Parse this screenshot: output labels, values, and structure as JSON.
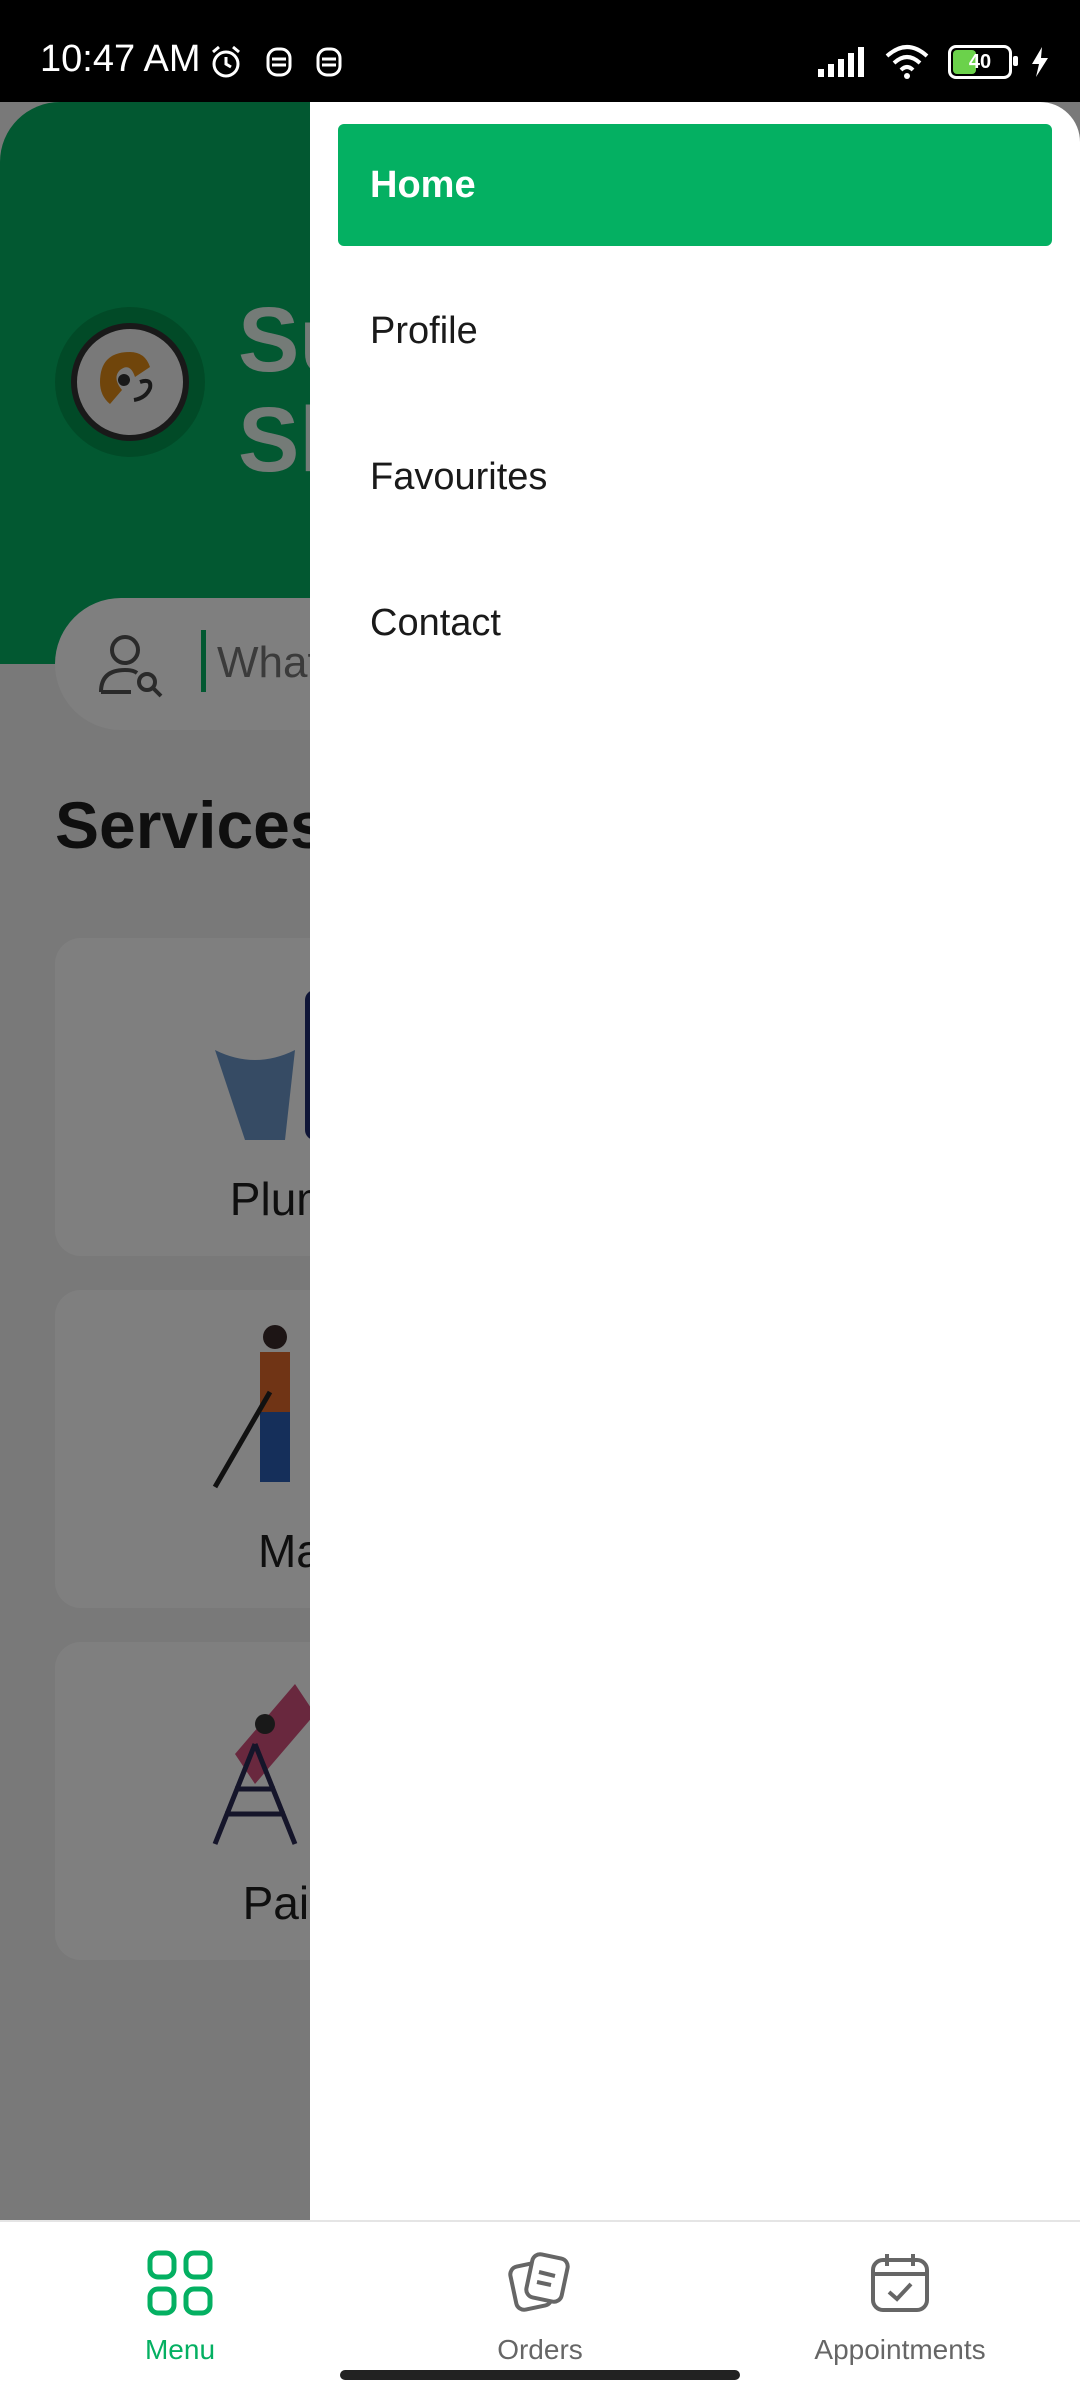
{
  "status_bar": {
    "time": "10:47 AM",
    "battery": "40"
  },
  "app": {
    "brand_text": "Su\nSl",
    "search": {
      "placeholder": "What"
    },
    "services_title": "Services",
    "services": [
      {
        "label": "Plumb"
      },
      {
        "label": "Mai"
      },
      {
        "label": "Paint"
      }
    ]
  },
  "drawer": {
    "items": [
      {
        "label": "Home",
        "active": true
      },
      {
        "label": "Profile",
        "active": false
      },
      {
        "label": "Favourites",
        "active": false
      },
      {
        "label": "Contact",
        "active": false
      }
    ]
  },
  "bottom_nav": {
    "items": [
      {
        "label": "Menu",
        "icon": "grid-icon",
        "active": true
      },
      {
        "label": "Orders",
        "icon": "orders-icon",
        "active": false
      },
      {
        "label": "Appointments",
        "icon": "calendar-check-icon",
        "active": false
      }
    ]
  },
  "colors": {
    "accent": "#04b062",
    "dim_overlay": "rgba(0,0,0,0.5)"
  }
}
